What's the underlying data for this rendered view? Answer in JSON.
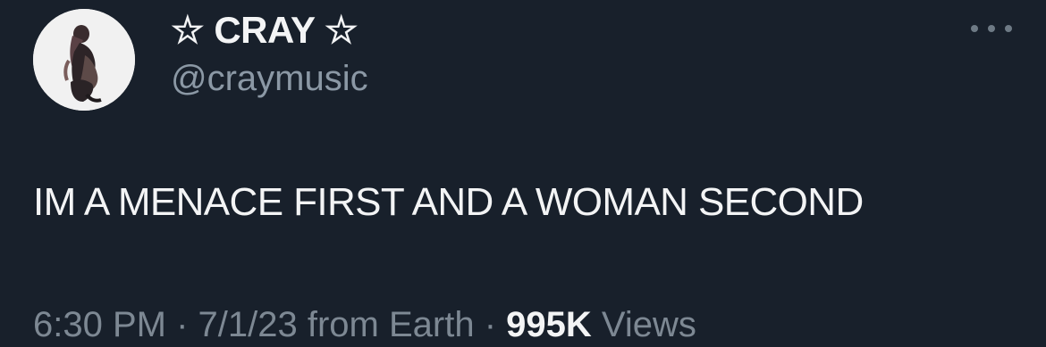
{
  "author": {
    "display_name": "☆ CRAY ☆",
    "handle": "@craymusic",
    "avatar_icon": "profile-photo"
  },
  "menu": {
    "icon": "more-options-icon"
  },
  "tweet": {
    "text": "IM A MENACE FIRST AND A WOMAN SECOND"
  },
  "meta": {
    "time": "6:30 PM",
    "separator": " · ",
    "date": "7/1/23",
    "source": "from Earth",
    "views_count": "995K",
    "views_label": "Views"
  },
  "colors": {
    "background": "#18202b",
    "text_primary": "#f3f4f5",
    "text_secondary": "#7d8893"
  }
}
